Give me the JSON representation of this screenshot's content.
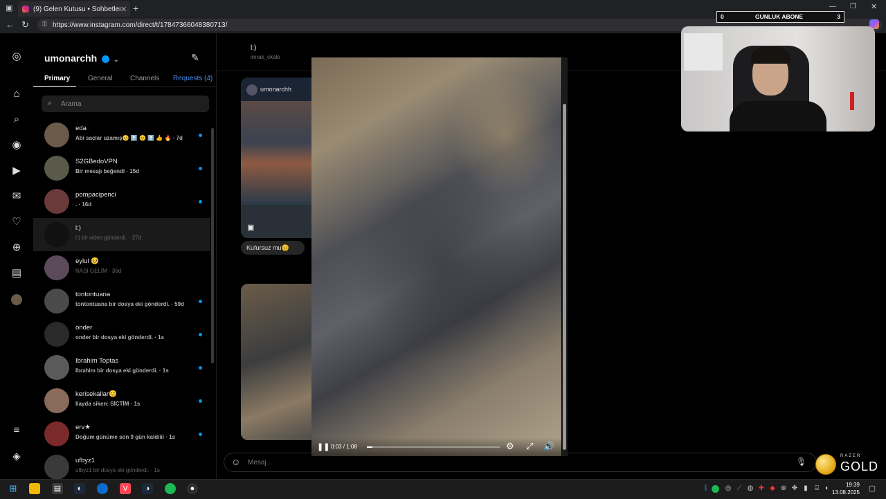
{
  "browser": {
    "tab_title": "(9) Gelen Kutusu • Sohbetler",
    "url": "https://www.instagram.com/direct/t/17847366048380713/"
  },
  "inbox": {
    "username": "umonarchh",
    "tabs": [
      "Primary",
      "General",
      "Channels",
      "Requests (4)"
    ],
    "search_placeholder": "Arama",
    "conversations": [
      {
        "name": "eda",
        "preview": "Abi saclar uzamış😊 ⬆️ 😊 ⬆️ 👍 🔥 · 7d",
        "unread": true,
        "avatar_color": "#6b5a4a"
      },
      {
        "name": "S2GBedoVPN",
        "preview": "Bir mesajı beğendi · 15d",
        "unread": true,
        "avatar_color": "#5a5a4a"
      },
      {
        "name": "pompacipenci",
        "preview": ". · 16d",
        "unread": true,
        "avatar_color": "#6a3a3a"
      },
      {
        "name": "l:)",
        "preview": "l:) bir video gönderdi. · 27d",
        "unread": false,
        "avatar_color": "#111111"
      },
      {
        "name": "eylul 🥺",
        "preview": "NASI GELİM · 36d",
        "unread": false,
        "avatar_color": "#5a4a5a"
      },
      {
        "name": "tontontuana",
        "preview": "tontontuana bir dosya eki gönderdi. · 59d",
        "unread": true,
        "avatar_color": "#4a4a4a"
      },
      {
        "name": "onder",
        "preview": "onder bir dosya eki gönderdi. · 1s",
        "unread": true,
        "avatar_color": "#2a2a2a"
      },
      {
        "name": "Ibrahim Toptas",
        "preview": "Ibrahim bir dosya eki gönderdi. · 1s",
        "unread": true,
        "avatar_color": "#5a5a5a"
      },
      {
        "name": "kerisekallar😊",
        "preview": "Ilayda siken: SİCTİM · 1s",
        "unread": true,
        "avatar_color": "#8a6a5a"
      },
      {
        "name": "erv★",
        "preview": "Doğum günüme son 9 gün kaldıiii · 1s",
        "unread": true,
        "avatar_color": "#7a2a2a"
      },
      {
        "name": "ufbyz1",
        "preview": "ufbyz1 bir dosya eki gönderdi. · 1s",
        "unread": false,
        "avatar_color": "#3a3a3a"
      }
    ]
  },
  "chat": {
    "header_name": "l:)",
    "header_sub": "imrak_ckale",
    "shared_post_user": "umonarchh",
    "message_text": "Kufursuz mu😊",
    "composer_placeholder": "Mesaj..."
  },
  "video": {
    "time": "0:03 / 1:08",
    "progress": 0.04
  },
  "overlay": {
    "counter_left": "0",
    "counter_title": "GUNLUK ABONE",
    "counter_right": "3",
    "brand_small": "RAZER",
    "brand_big": "GOLD"
  },
  "taskbar": {
    "time": "19:39",
    "date": "13.08.2025"
  }
}
